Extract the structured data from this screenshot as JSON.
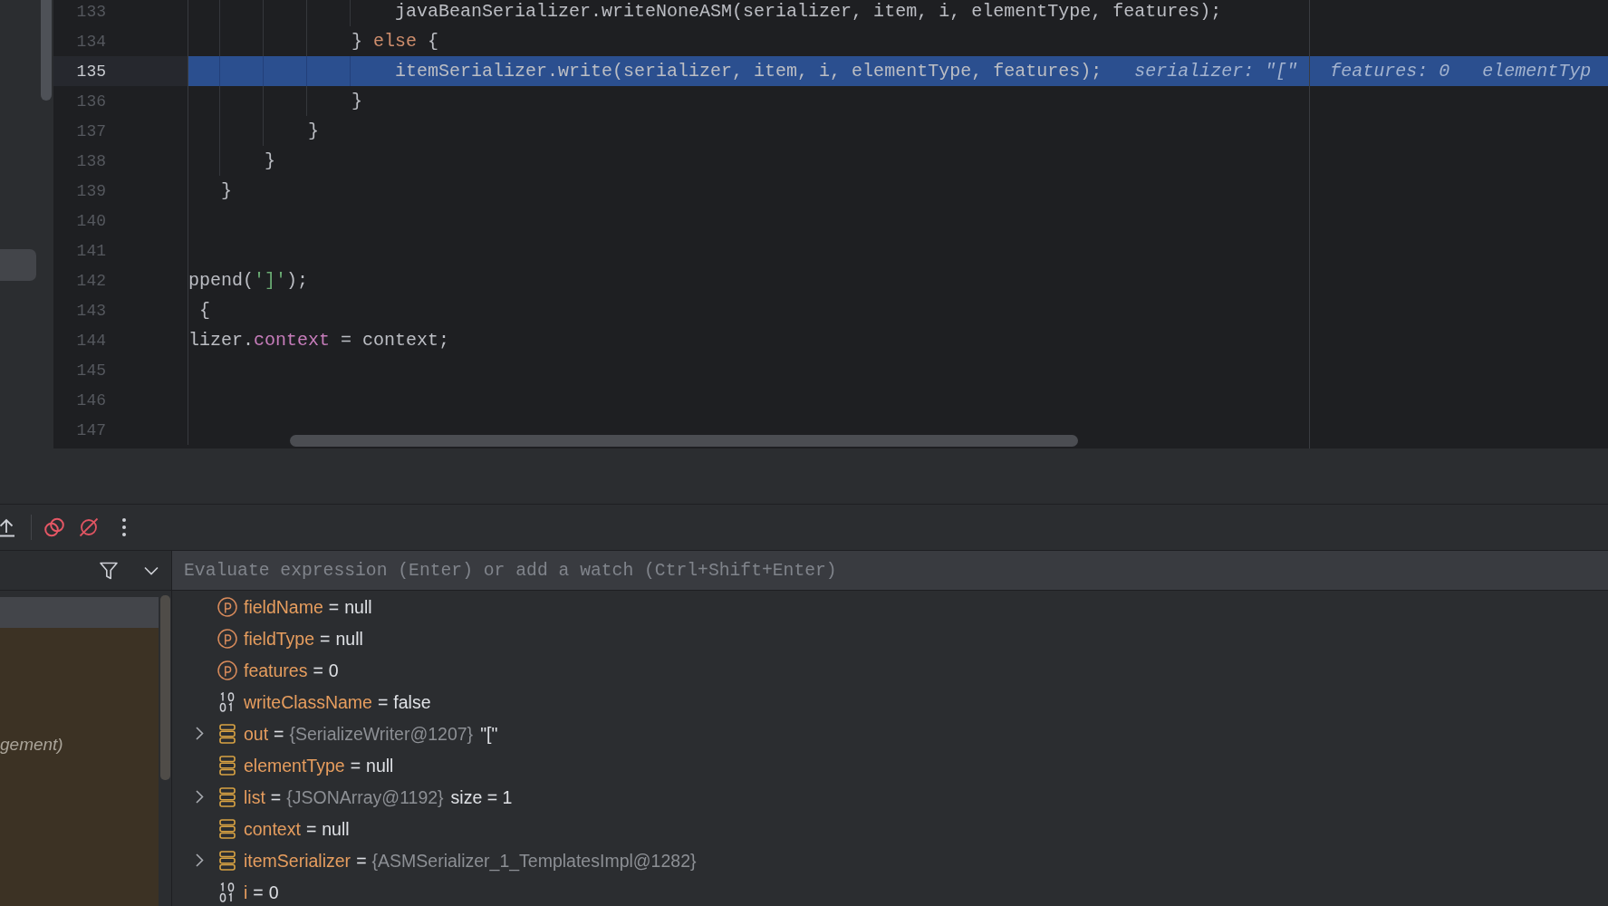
{
  "editor": {
    "lines": [
      {
        "number": "133",
        "current": false,
        "tokens": [
          {
            "kind": "plain",
            "text": "                   javaBeanSerializer.writeNoneASM(serializer, item, i, elementType, features);"
          }
        ]
      },
      {
        "number": "134",
        "current": false,
        "tokens": [
          {
            "kind": "plain",
            "text": "               } "
          },
          {
            "kind": "keyword",
            "text": "else"
          },
          {
            "kind": "plain",
            "text": " {"
          }
        ]
      },
      {
        "number": "135",
        "current": true,
        "tokens": [
          {
            "kind": "plain",
            "text": "                   itemSerializer.write(serializer, item, i, elementType, features);"
          }
        ],
        "inline_values": [
          "serializer: \"[\"",
          "features: 0",
          "elementTyp"
        ]
      },
      {
        "number": "136",
        "current": false,
        "tokens": [
          {
            "kind": "plain",
            "text": "               }"
          }
        ]
      },
      {
        "number": "137",
        "current": false,
        "tokens": [
          {
            "kind": "plain",
            "text": "           }"
          }
        ]
      },
      {
        "number": "138",
        "current": false,
        "tokens": [
          {
            "kind": "plain",
            "text": "       }"
          }
        ]
      },
      {
        "number": "139",
        "current": false,
        "tokens": [
          {
            "kind": "plain",
            "text": "   }"
          }
        ]
      },
      {
        "number": "140",
        "current": false
      },
      {
        "number": "141",
        "current": false
      },
      {
        "number": "142",
        "current": false,
        "tokens": [
          {
            "kind": "plain",
            "text": "ppend("
          },
          {
            "kind": "string",
            "text": "']'"
          },
          {
            "kind": "plain",
            "text": ");"
          }
        ]
      },
      {
        "number": "143",
        "current": false,
        "tokens": [
          {
            "kind": "plain",
            "text": " {"
          }
        ]
      },
      {
        "number": "144",
        "current": false,
        "tokens": [
          {
            "kind": "plain",
            "text": "lizer."
          },
          {
            "kind": "field",
            "text": "context"
          },
          {
            "kind": "plain",
            "text": " = context;"
          }
        ]
      },
      {
        "number": "145",
        "current": false
      },
      {
        "number": "146",
        "current": false
      },
      {
        "number": "147",
        "current": false
      }
    ]
  },
  "debugger": {
    "frames": [
      {
        "selected": true
      },
      {
        "label": "gement)",
        "selected": false
      }
    ],
    "evaluate": {
      "placeholder": "Evaluate expression (Enter) or add a watch (Ctrl+Shift+Enter)"
    },
    "variables": [
      {
        "kind": "parameter",
        "expandable": false,
        "name": "fieldName",
        "operator": "=",
        "value": "null"
      },
      {
        "kind": "parameter",
        "expandable": false,
        "name": "fieldType",
        "operator": "=",
        "value": "null"
      },
      {
        "kind": "parameter",
        "expandable": false,
        "name": "features",
        "operator": "=",
        "value": "0"
      },
      {
        "kind": "primitive",
        "expandable": false,
        "name": "writeClassName",
        "operator": "=",
        "value": "false"
      },
      {
        "kind": "field",
        "expandable": true,
        "expanded": false,
        "name": "out",
        "operator": "=",
        "type": "{SerializeWriter@1207}",
        "value": "\"[\""
      },
      {
        "kind": "field",
        "expandable": false,
        "name": "elementType",
        "operator": "=",
        "value": "null"
      },
      {
        "kind": "field",
        "expandable": true,
        "expanded": false,
        "name": "list",
        "operator": "=",
        "type": "{JSONArray@1192}",
        "value": "size = 1"
      },
      {
        "kind": "field",
        "expandable": false,
        "name": "context",
        "operator": "=",
        "value": "null"
      },
      {
        "kind": "field",
        "expandable": true,
        "expanded": false,
        "name": "itemSerializer",
        "operator": "=",
        "type": "{ASMSerializer_1_TemplatesImpl@1282}"
      },
      {
        "kind": "primitive",
        "expandable": false,
        "name": "i",
        "operator": "=",
        "value": "0"
      }
    ]
  }
}
